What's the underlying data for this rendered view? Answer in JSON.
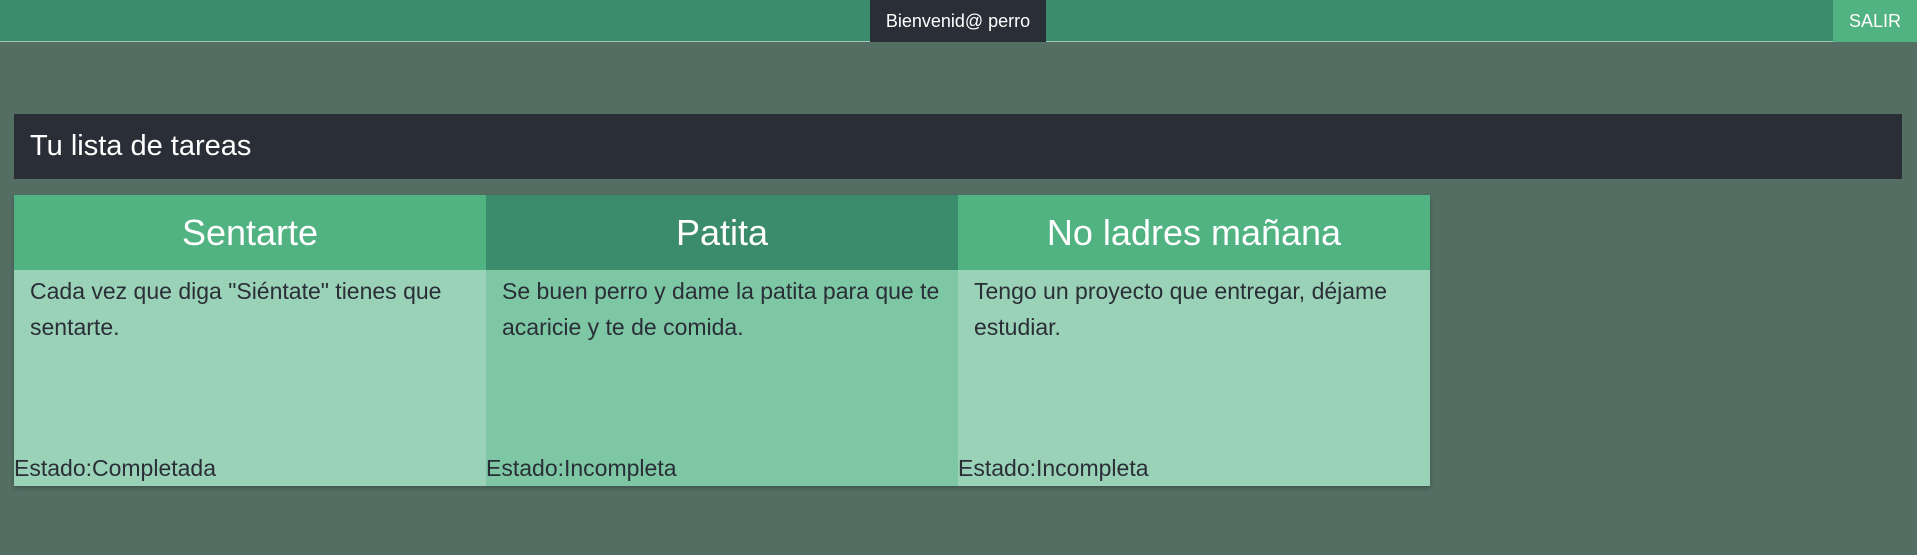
{
  "header": {
    "welcome": "Bienvenid@ perro",
    "logout_label": "SALIR"
  },
  "tasks_title": "Tu lista de tareas",
  "tasks": [
    {
      "title": "Sentarte",
      "description": "Cada vez que diga \"Siéntate\" tienes que sentarte.",
      "status": "Estado:Completada"
    },
    {
      "title": "Patita",
      "description": "Se buen perro y dame la patita para que te acaricie y te de comida.",
      "status": "Estado:Incompleta"
    },
    {
      "title": "No ladres mañana",
      "description": "Tengo un proyecto que entregar, déjame estudiar.",
      "status": "Estado:Incompleta"
    }
  ],
  "colors": {
    "background": "#546e64",
    "topbar": "#3b8b6d",
    "dark": "#2a2e36",
    "accent": "#51b282",
    "card_light": "#9ad2b8",
    "card_mid": "#7dc7a4"
  }
}
